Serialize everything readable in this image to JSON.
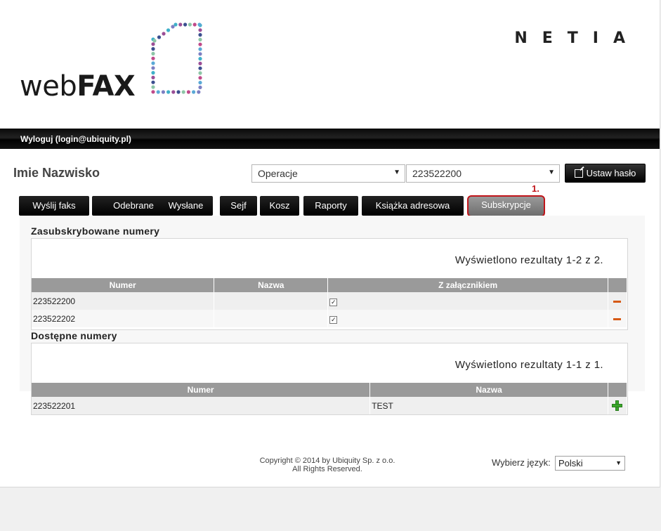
{
  "header": {
    "logo_web": "web",
    "logo_fax": "FAX",
    "brand": "NETIA"
  },
  "topbar": {
    "logout_label": "Wyloguj (login@ubiquity.pl)"
  },
  "user": {
    "name": "Imie Nazwisko"
  },
  "controls": {
    "operations_select": "Operacje",
    "number_select": "223522200",
    "set_password_label": "Ustaw hasło"
  },
  "marker": "1.",
  "tabs": [
    {
      "label": "Wyślij faks"
    },
    {
      "label": "Odebrane"
    },
    {
      "label": "Wysłane"
    },
    {
      "label": "Sejf"
    },
    {
      "label": "Kosz"
    },
    {
      "label": "Raporty"
    },
    {
      "label": "Książka adresowa"
    },
    {
      "label": "Subskrypcje",
      "active": true
    }
  ],
  "subscribed": {
    "title": "Zasubskrybowane numery",
    "results_text": "Wyświetlono rezultaty 1-2 z 2.",
    "columns": [
      "Numer",
      "Nazwa",
      "Z załącznikiem"
    ],
    "rows": [
      {
        "numer": "223522200",
        "nazwa": "",
        "attachment": true
      },
      {
        "numer": "223522202",
        "nazwa": "",
        "attachment": true
      }
    ]
  },
  "available": {
    "title": "Dostępne numery",
    "results_text": "Wyświetlono rezultaty 1-1 z 1.",
    "columns": [
      "Numer",
      "Nazwa"
    ],
    "rows": [
      {
        "numer": "223522201",
        "nazwa": "TEST"
      }
    ]
  },
  "footer": {
    "copyright_line1": "Copyright © 2014 by Ubiquity Sp. z o.o.",
    "copyright_line2": "All Rights Reserved.",
    "language_label": "Wybierz język:",
    "language_value": "Polski"
  },
  "icons": {
    "remove": "minus-icon",
    "add": "plus-icon",
    "edit": "edit-icon"
  },
  "colors": {
    "accent_red": "#c0151a",
    "remove_orange": "#d65a16",
    "add_green": "#3aa72a"
  }
}
